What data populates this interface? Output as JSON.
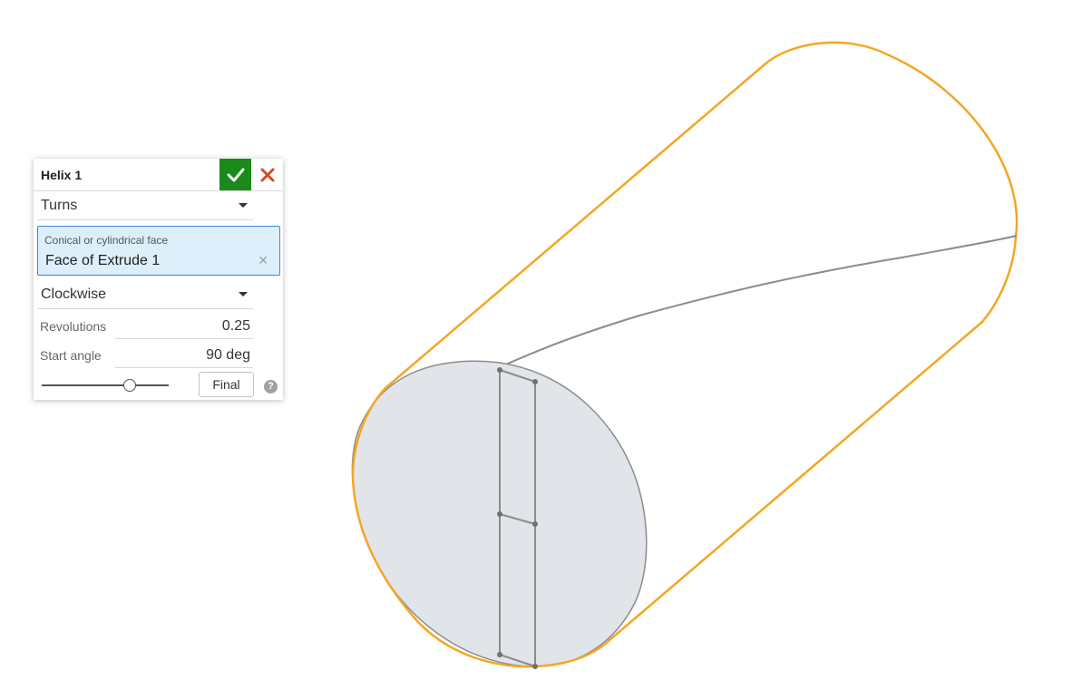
{
  "dialog": {
    "title": "Helix 1",
    "accept_icon": "check-icon",
    "cancel_icon": "close-icon",
    "type_dropdown": {
      "selected": "Turns"
    },
    "face_selection": {
      "caption": "Conical or cylindrical face",
      "value": "Face of Extrude 1"
    },
    "direction_dropdown": {
      "selected": "Clockwise"
    },
    "revolutions": {
      "label": "Revolutions",
      "value": "0.25"
    },
    "start_angle": {
      "label": "Start angle",
      "value": "90 deg"
    },
    "rollback_slider": {
      "position_fraction": 0.69
    },
    "final_button": {
      "label": "Final"
    },
    "help_icon": "help-icon"
  },
  "colors": {
    "accept_green": "#1a8a1a",
    "cancel_red": "#d9462b",
    "selection_highlight": "#f5a623",
    "face_fill": "#e1e4e8",
    "edge_gray": "#8c8c8c",
    "field_selected_bg": "#dceffa",
    "field_selected_border": "#3b8ad0"
  }
}
